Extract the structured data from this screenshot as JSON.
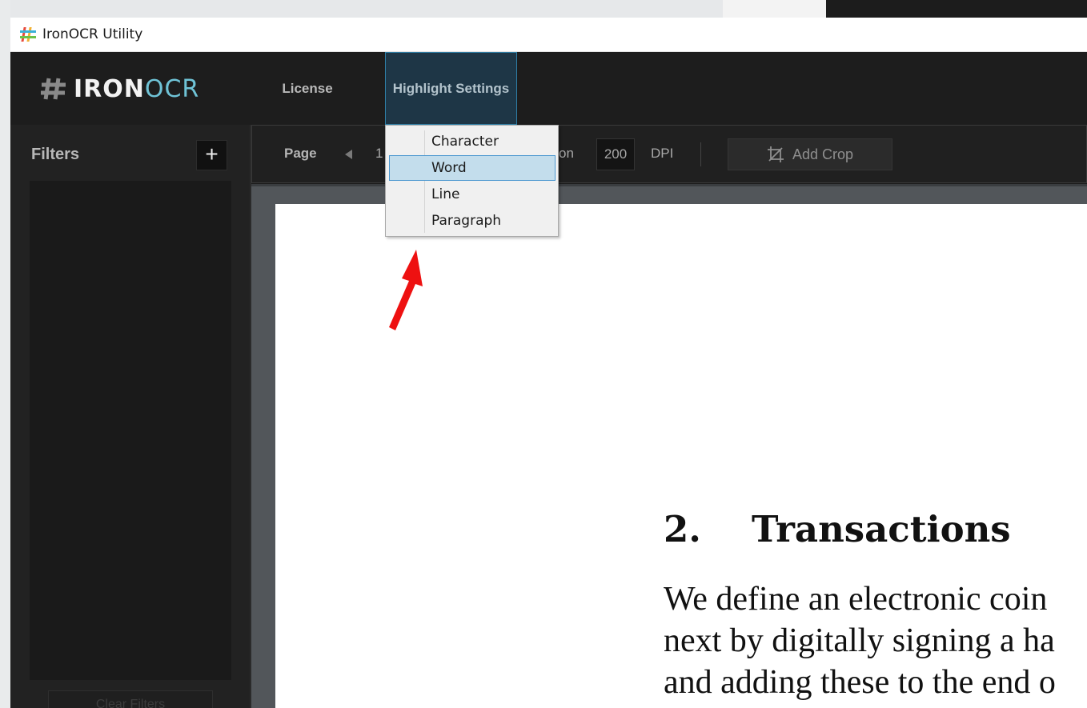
{
  "window": {
    "title": "IronOCR Utility"
  },
  "brand": {
    "logo_strong": "IRON",
    "logo_light": "OCR",
    "accent_color": "#6fc3d6"
  },
  "nav": {
    "license_label": "License",
    "highlight_settings_label": "Highlight Settings"
  },
  "highlight_menu": {
    "options": [
      "Character",
      "Word",
      "Line",
      "Paragraph"
    ],
    "selected": "Word"
  },
  "sidebar": {
    "title": "Filters",
    "add_label": "+",
    "clear_label": "Clear Filters"
  },
  "toolbar": {
    "page_label": "Page",
    "page_number": "1",
    "resolution_label_partial": "on",
    "dpi_value": "200",
    "dpi_label": "DPI",
    "add_crop_label": "Add Crop"
  },
  "document": {
    "section_number": "2.",
    "section_title": "Transactions",
    "lines": [
      "We define an electronic coin",
      "next by digitally signing a ha",
      "and adding these to the end o"
    ]
  }
}
